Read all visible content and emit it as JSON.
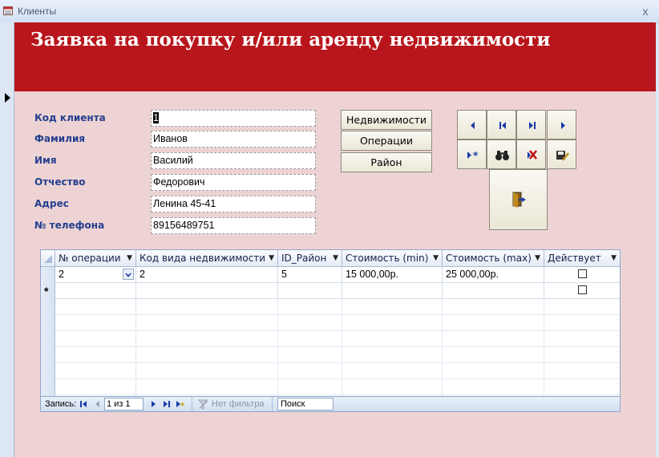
{
  "window": {
    "title": "Клиенты",
    "close_glyph": "x"
  },
  "header": {
    "title": "Заявка на покупку и/или аренду недвижимости",
    "color": "#b8161c"
  },
  "form_bg": "#eed3d4",
  "fields": [
    {
      "label": "Код клиента",
      "value": "1"
    },
    {
      "label": "Фамилия",
      "value": "Иванов"
    },
    {
      "label": "Имя",
      "value": "Василий"
    },
    {
      "label": "Отчество",
      "value": "Федорович"
    },
    {
      "label": "Адрес",
      "value": "Ленина 45-41"
    },
    {
      "label": "№ телефона",
      "value": "89156489751"
    }
  ],
  "buttons": {
    "realty": "Недвижимости",
    "operations": "Операции",
    "district": "Район"
  },
  "nav_icons": [
    "prev-record-icon",
    "first-record-icon",
    "last-record-icon",
    "next-record-icon",
    "new-record-icon",
    "find-icon",
    "delete-record-icon",
    "save-record-icon",
    "exit-icon"
  ],
  "subform": {
    "columns": [
      "№ операции",
      "Код вида недвижимости",
      "ID_Район",
      "Стоимость (min)",
      "Стоимость (max)",
      "Действует"
    ],
    "rows": [
      {
        "op": "2",
        "kind": "2",
        "district": "5",
        "min": "15 000,00р.",
        "max": "25 000,00р.",
        "active": false
      }
    ],
    "new_row_marker": "*",
    "navigation": {
      "record_label": "Запись:",
      "position": "1 из 1",
      "filter": "Нет фильтра",
      "search": "Поиск"
    }
  }
}
